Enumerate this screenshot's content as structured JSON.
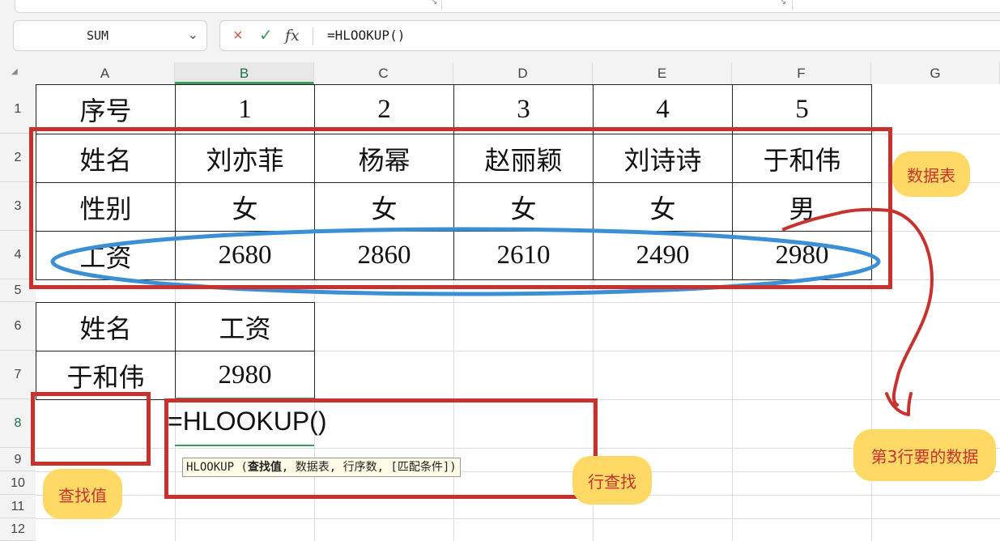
{
  "toolbar": {
    "name_box": "SUM",
    "cancel_icon": "×",
    "confirm_icon": "✓",
    "fx_icon": "fx",
    "formula_text": "=HLOOKUP()"
  },
  "columns": [
    "A",
    "B",
    "C",
    "D",
    "E",
    "F",
    "G"
  ],
  "rows": [
    "1",
    "2",
    "3",
    "4",
    "5",
    "6",
    "7",
    "8",
    "9",
    "10",
    "11",
    "12"
  ],
  "table": {
    "row1": [
      "序号",
      "1",
      "2",
      "3",
      "4",
      "5"
    ],
    "row2": [
      "姓名",
      "刘亦菲",
      "杨幂",
      "赵丽颖",
      "刘诗诗",
      "于和伟"
    ],
    "row3": [
      "性别",
      "女",
      "女",
      "女",
      "女",
      "男"
    ],
    "row4": [
      "工资",
      "2680",
      "2860",
      "2610",
      "2490",
      "2980"
    ]
  },
  "lookup": {
    "h1": "姓名",
    "h2": "工资",
    "v1": "于和伟",
    "v2": "2980"
  },
  "editing_formula": "=HLOOKUP()",
  "tooltip": {
    "func": "HLOOKUP (",
    "arg1": "查找值",
    "rest": ", 数据表, 行序数, [匹配条件])"
  },
  "annotations": {
    "data_table": "数据表",
    "third_row": "第3行要的数据",
    "lookup_value": "查找值",
    "row_lookup": "行查找"
  },
  "colors": {
    "red_annotation": "#c8322e",
    "blue_ellipse": "#3a8fd6",
    "bubble_fill": "#ffd966",
    "selection_green": "#3c9a5f"
  }
}
